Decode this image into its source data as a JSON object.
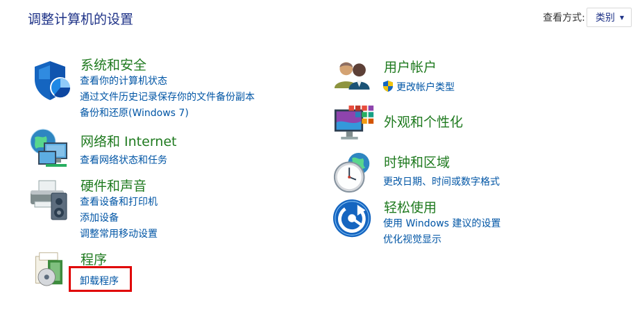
{
  "header": {
    "title": "调整计算机的设置",
    "view_by_label": "查看方式:",
    "view_by_value": "类别"
  },
  "left_column": [
    {
      "title": "系统和安全",
      "icon": "security-shield-icon",
      "links": [
        "查看你的计算机状态",
        "通过文件历史记录保存你的文件备份副本",
        "备份和还原(Windows 7)"
      ]
    },
    {
      "title": "网络和 Internet",
      "icon": "network-globe-icon",
      "links": [
        "查看网络状态和任务"
      ]
    },
    {
      "title": "硬件和声音",
      "icon": "printer-speaker-icon",
      "links": [
        "查看设备和打印机",
        "添加设备",
        "调整常用移动设置"
      ]
    },
    {
      "title": "程序",
      "icon": "programs-disc-icon",
      "links": [
        "卸载程序"
      ]
    }
  ],
  "right_column": [
    {
      "title": "用户帐户",
      "icon": "users-icon",
      "links": [
        "更改帐户类型"
      ]
    },
    {
      "title": "外观和个性化",
      "icon": "monitor-palette-icon",
      "links": []
    },
    {
      "title": "时钟和区域",
      "icon": "clock-globe-icon",
      "links": [
        "更改日期、时间或数字格式"
      ]
    },
    {
      "title": "轻松使用",
      "icon": "ease-of-access-icon",
      "links": [
        "使用 Windows 建议的设置",
        "优化视觉显示"
      ]
    }
  ],
  "colors": {
    "title_blue": "#1e3287",
    "category_green": "#1f7a1f",
    "link_blue": "#0055a5",
    "highlight_red": "#e00000"
  }
}
